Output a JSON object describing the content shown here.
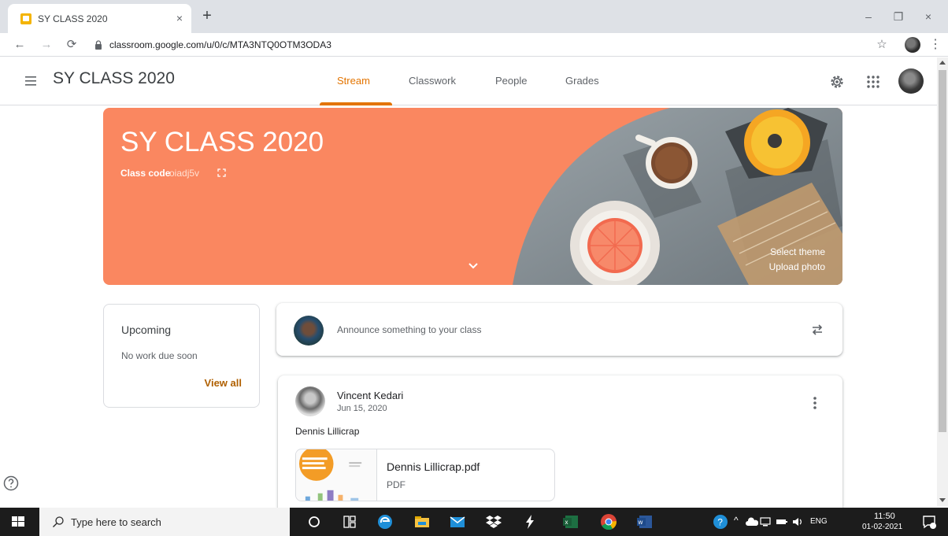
{
  "browser": {
    "tab_title": "SY CLASS 2020",
    "tab_close": "×",
    "new_tab": "+",
    "url": "classroom.google.com/u/0/c/MTA3NTQ0OTM3ODA3",
    "window_controls": {
      "minimize": "–",
      "restore": "❐",
      "close": "×"
    }
  },
  "header": {
    "class_title": "SY CLASS 2020",
    "tabs": [
      {
        "label": "Stream",
        "active": true
      },
      {
        "label": "Classwork",
        "active": false
      },
      {
        "label": "People",
        "active": false
      },
      {
        "label": "Grades",
        "active": false
      }
    ]
  },
  "banner": {
    "title": "SY CLASS 2020",
    "class_code_label": "Class code",
    "class_code": "oiadj5v",
    "select_theme": "Select theme",
    "upload_photo": "Upload photo"
  },
  "upcoming": {
    "title": "Upcoming",
    "empty_text": "No work due soon",
    "view_all": "View all"
  },
  "announce": {
    "placeholder": "Announce something to your class"
  },
  "post": {
    "author": "Vincent Kedari",
    "date": "Jun 15, 2020",
    "text": "Dennis Lillicrap",
    "attachment": {
      "name": "Dennis Lillicrap.pdf",
      "type": "PDF"
    }
  },
  "taskbar": {
    "search_placeholder": "Type here to search",
    "language": "ENG",
    "time": "11:50",
    "date": "01-02-2021"
  },
  "colors": {
    "banner": "#fa8760",
    "accent": "#e37400",
    "view_all": "#b06000"
  }
}
